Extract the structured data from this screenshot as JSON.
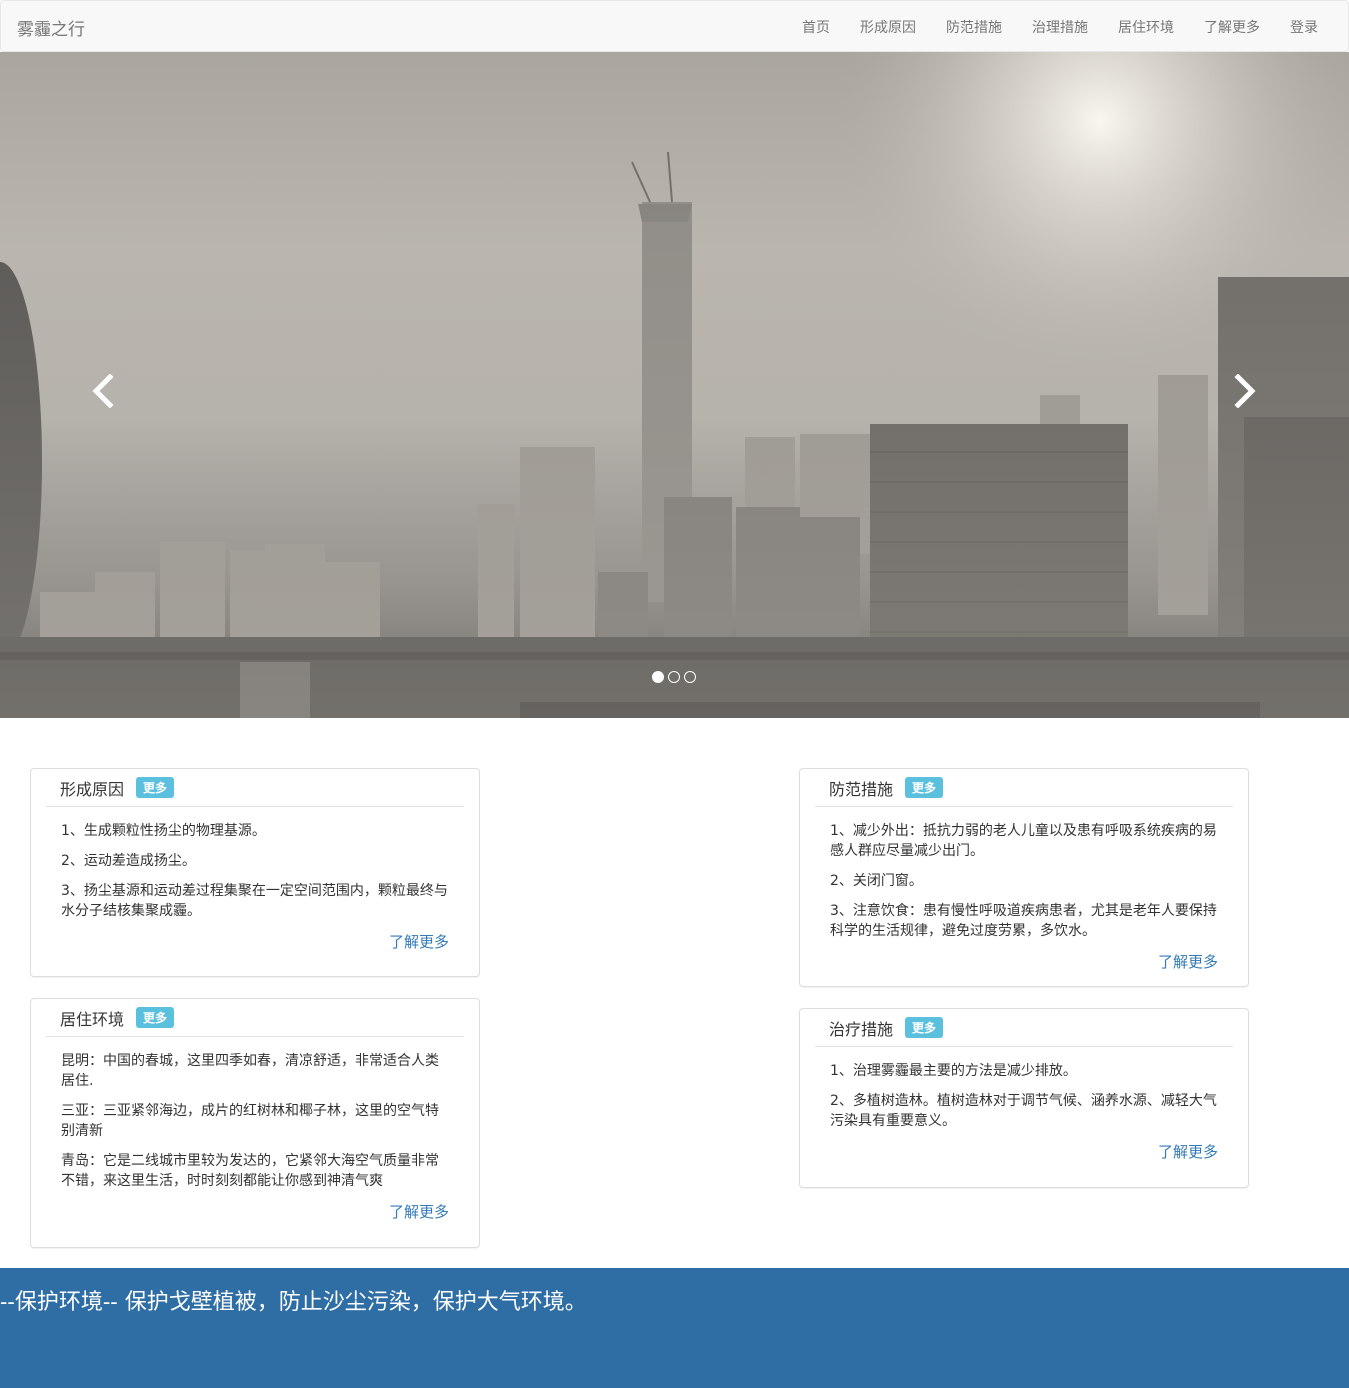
{
  "navbar": {
    "brand": "雾霾之行",
    "items": [
      "首页",
      "形成原因",
      "防范措施",
      "治理措施",
      "居住环境",
      "了解更多",
      "登录"
    ]
  },
  "carousel": {
    "image": "haze-city-skyline",
    "slide_count": 3,
    "active_slide": 1
  },
  "panels": {
    "causes": {
      "title": "形成原因",
      "badge": "更多",
      "items": [
        "1、生成颗粒性扬尘的物理基源。",
        "2、运动差造成扬尘。",
        "3、扬尘基源和运动差过程集聚在一定空间范围内，颗粒最终与水分子结核集聚成霾。"
      ],
      "more": "了解更多"
    },
    "prevention": {
      "title": "防范措施",
      "badge": "更多",
      "items": [
        "1、减少外出：抵抗力弱的老人儿童以及患有呼吸系统疾病的易感人群应尽量减少出门。",
        "2、关闭门窗。",
        "3、注意饮食：患有慢性呼吸道疾病患者，尤其是老年人要保持科学的生活规律，避免过度劳累，多饮水。"
      ],
      "more": "了解更多"
    },
    "living": {
      "title": "居住环境",
      "badge": "更多",
      "items": [
        "昆明：中国的春城，这里四季如春，清凉舒适，非常适合人类居住.",
        "三亚：三亚紧邻海边，成片的红树林和椰子林，这里的空气特别清新",
        "青岛：它是二线城市里较为发达的，它紧邻大海空气质量非常不错，来这里生活，时时刻刻都能让你感到神清气爽"
      ],
      "more": "了解更多"
    },
    "treatment": {
      "title": "治疗措施",
      "badge": "更多",
      "items": [
        "1、治理雾霾最主要的方法是减少排放。",
        "2、多植树造林。植树造林对于调节气候、涵养水源、减轻大气污染具有重要意义。"
      ],
      "more": "了解更多"
    }
  },
  "footer": {
    "text": "--保护环境-- 保护戈壁植被，防止沙尘污染，保护大气环境。"
  }
}
